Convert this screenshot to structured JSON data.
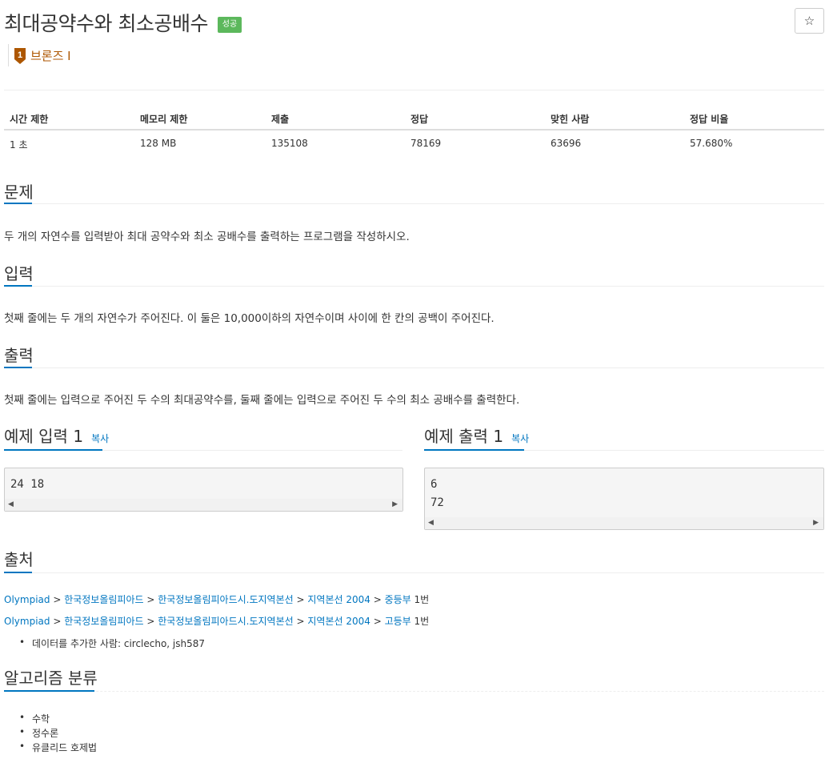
{
  "problem": {
    "title": "최대공약수와 최소공배수",
    "status_badge": "성공",
    "star_icon": "☆",
    "tier": {
      "number": "1",
      "label": "브론즈 I"
    }
  },
  "stats": {
    "headers": [
      "시간 제한",
      "메모리 제한",
      "제출",
      "정답",
      "맞힌 사람",
      "정답 비율"
    ],
    "values": [
      "1 초",
      "128 MB",
      "135108",
      "78169",
      "63696",
      "57.680%"
    ]
  },
  "sections": {
    "description": {
      "title": "문제",
      "text": "두 개의 자연수를 입력받아 최대 공약수와 최소 공배수를 출력하는 프로그램을 작성하시오."
    },
    "input": {
      "title": "입력",
      "text": "첫째 줄에는 두 개의 자연수가 주어진다. 이 둘은 10,000이하의 자연수이며 사이에 한 칸의 공백이 주어진다."
    },
    "output": {
      "title": "출력",
      "text": "첫째 줄에는 입력으로 주어진 두 수의 최대공약수를, 둘째 줄에는 입력으로 주어진 두 수의 최소 공배수를 출력한다."
    }
  },
  "samples": {
    "input": {
      "title": "예제 입력 1",
      "copy_label": "복사",
      "content": "24 18"
    },
    "output": {
      "title": "예제 출력 1",
      "copy_label": "복사",
      "lines": [
        "6",
        "72"
      ]
    }
  },
  "source": {
    "title": "출처",
    "paths": [
      {
        "links": [
          "Olympiad",
          "한국정보올림피아드",
          "한국정보올림피아드시.도지역본선",
          "지역본선 2004",
          "중등부"
        ],
        "suffix": "1번"
      },
      {
        "links": [
          "Olympiad",
          "한국정보올림피아드",
          "한국정보올림피아드시.도지역본선",
          "지역본선 2004",
          "고등부"
        ],
        "suffix": "1번"
      }
    ],
    "data_added": "데이터를 추가한 사람: circlecho, jsh587"
  },
  "algorithms": {
    "title": "알고리즘 분류",
    "items": [
      "수학",
      "정수론",
      "유클리드 호제법"
    ]
  },
  "colors": {
    "link": "#0076c0",
    "success": "#5cb85c",
    "bronze": "#ad5600",
    "section_line": "#0076c0"
  }
}
